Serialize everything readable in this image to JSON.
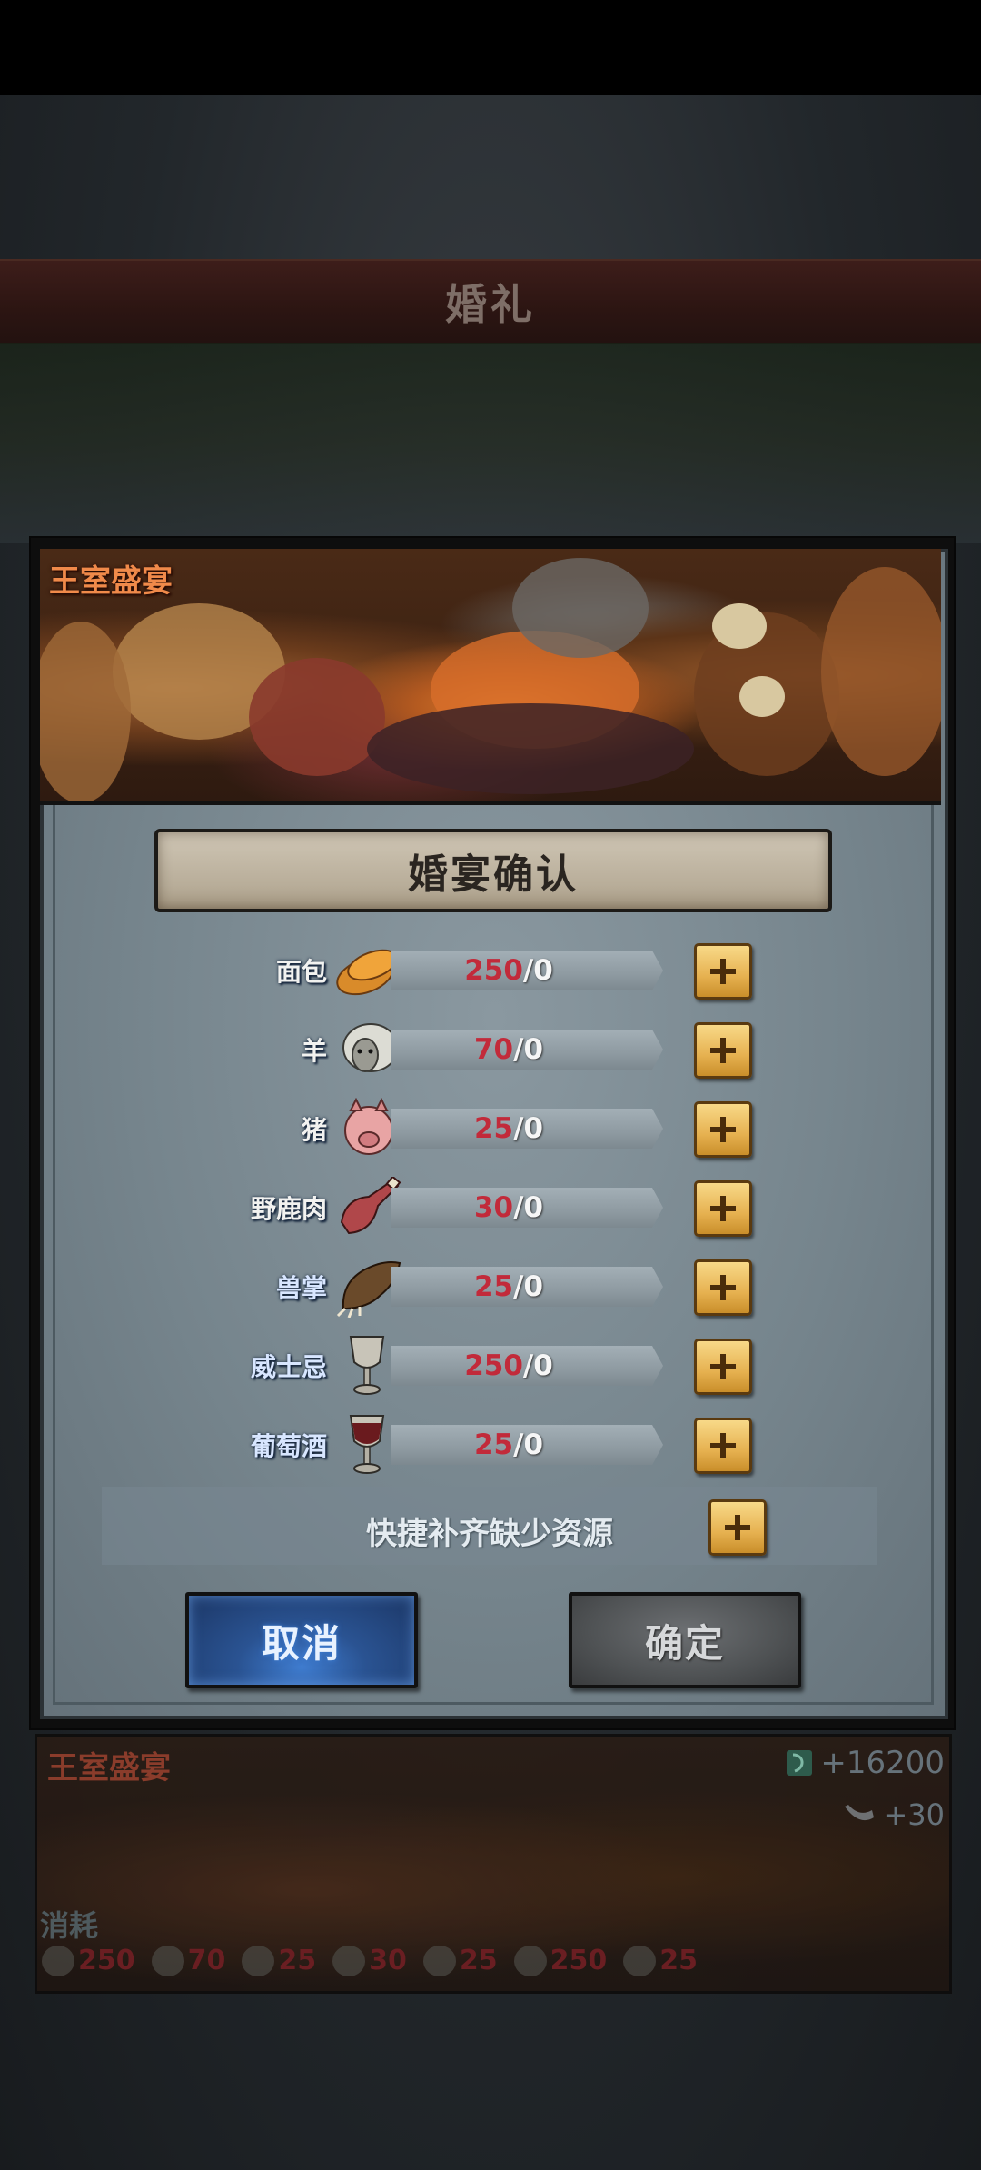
{
  "background": {
    "title": "婚礼"
  },
  "dialog": {
    "banner_title": "王室盛宴",
    "header": "婚宴确认",
    "resources": [
      {
        "label": "面包",
        "icon": "bread-icon",
        "need": "250",
        "have": "0",
        "label_style": "white"
      },
      {
        "label": "羊",
        "icon": "sheep-icon",
        "need": "70",
        "have": "0",
        "label_style": "white"
      },
      {
        "label": "猪",
        "icon": "pig-icon",
        "need": "25",
        "have": "0",
        "label_style": "white"
      },
      {
        "label": "野鹿肉",
        "icon": "venison-icon",
        "need": "30",
        "have": "0",
        "label_style": "white"
      },
      {
        "label": "兽掌",
        "icon": "beast-paw-icon",
        "need": "25",
        "have": "0",
        "label_style": "blue"
      },
      {
        "label": "威士忌",
        "icon": "whisky-goblet-icon",
        "need": "250",
        "have": "0",
        "label_style": "blue"
      },
      {
        "label": "葡萄酒",
        "icon": "wine-goblet-icon",
        "need": "25",
        "have": "0",
        "label_style": "blue"
      }
    ],
    "slash": "/",
    "quick_fill": "快捷补齐缺少资源",
    "cancel": "取消",
    "confirm": "确定"
  },
  "bottom_card": {
    "title": "王室盛宴",
    "gold_reward": "+16200",
    "horn_reward": "+30",
    "consume_label": "消耗",
    "costs": [
      "250",
      "70",
      "25",
      "30",
      "25",
      "250",
      "25"
    ]
  },
  "colors": {
    "need_red": "#c22a3a",
    "banner_title": "#f08a4a",
    "plus_gold": "#e6b150",
    "cancel_blue": "#2a5392"
  }
}
